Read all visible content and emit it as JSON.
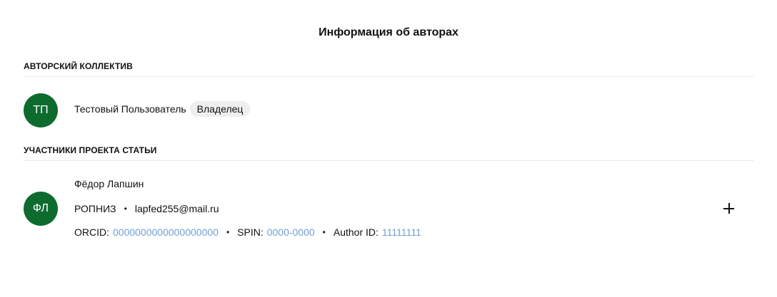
{
  "page": {
    "title": "Информация об авторах"
  },
  "authors_section": {
    "label": "АВТОРСКИЙ КОЛЛЕКТИВ",
    "author": {
      "initials": "ТП",
      "name": "Тестовый Пользователь",
      "role_badge": "Владелец"
    }
  },
  "participants_section": {
    "label": "УЧАСТНИКИ ПРОЕКТА СТАТЬИ",
    "participant": {
      "initials": "ФЛ",
      "name": "Фёдор Лапшин",
      "org": "РОПНИЗ",
      "email": "lapfed255@mail.ru",
      "orcid_label": "ORCID:",
      "orcid_value": "0000000000000000000",
      "spin_label": "SPIN:",
      "spin_value": "0000-0000",
      "author_id_label": "Author ID:",
      "author_id_value": "11111111",
      "separator": "•"
    },
    "add_icon": "plus-icon"
  },
  "colors": {
    "avatar": "#0d6b2e",
    "link": "#6f9fd8",
    "badge_bg": "#eeeeee"
  }
}
